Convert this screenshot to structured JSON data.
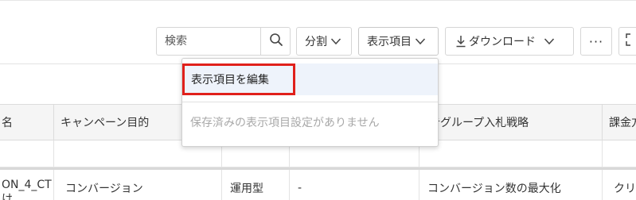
{
  "toolbar": {
    "search_placeholder": "検索",
    "split_label": "分割",
    "columns_label": "表示項目",
    "download_label": "ダウンロード",
    "more_label": "···"
  },
  "dropdown": {
    "edit_label": "表示項目を編集",
    "empty_text": "保存済みの表示項目設定がありません"
  },
  "table": {
    "headers": [
      "名",
      "キャンペーン目的",
      "",
      "",
      "告グループ入札戦略",
      "課金方"
    ],
    "row": [
      "ON_4_CT",
      "コンバージョン",
      "運用型",
      "-",
      "コンバージョン数の最大化",
      "クリ"
    ],
    "row_first_line2": "け"
  },
  "colors": {
    "highlight_border": "#e0201b",
    "dropdown_hover": "#eef3fb"
  }
}
